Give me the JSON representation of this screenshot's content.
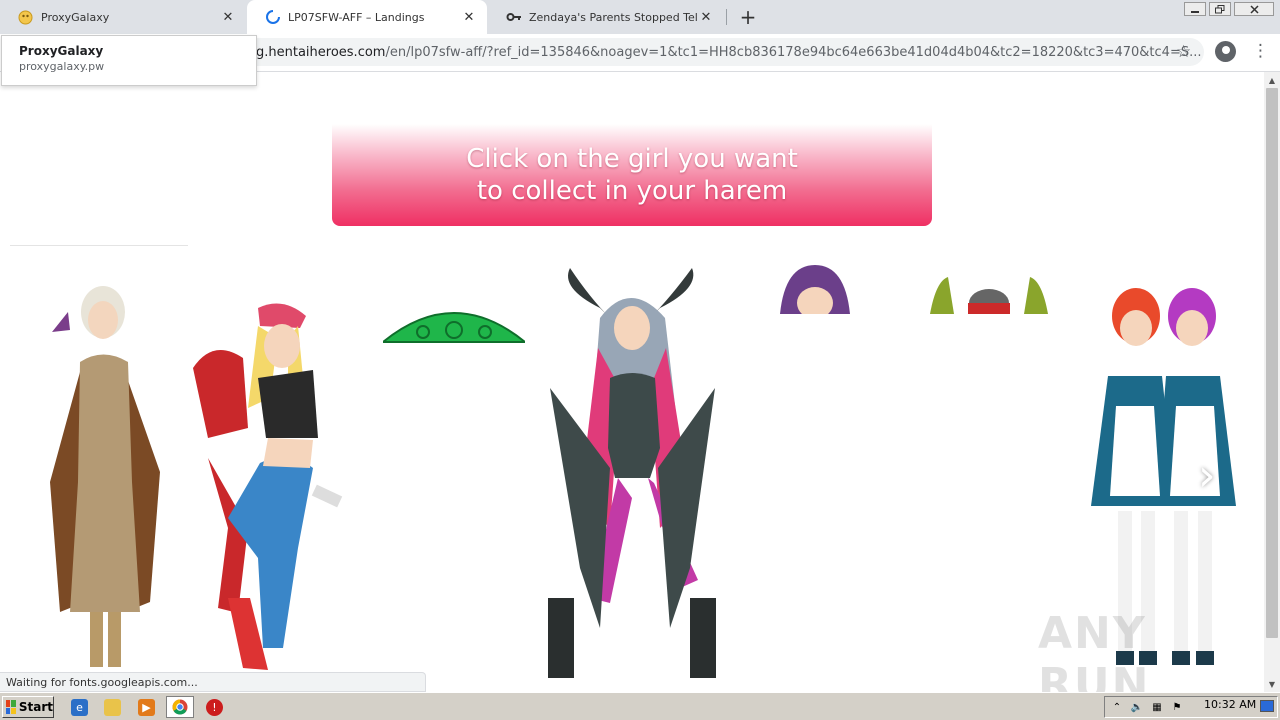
{
  "browser": {
    "tabs": [
      {
        "title": "ProxyGalaxy",
        "icon": "proxygalaxy-favicon",
        "active": false
      },
      {
        "title": "LP07SFW-AFF – Landings",
        "icon": "loading-spinner-icon",
        "active": true
      },
      {
        "title": "Zendaya's Parents Stopped Telling H",
        "icon": "key-icon",
        "active": false
      }
    ],
    "new_tab_glyph": "+",
    "close_glyph": "✕",
    "address": {
      "host": "g.hentaiheroes.com",
      "path": "/en/lp07sfw-aff/?ref_id=135846&noagev=1&tc1=HH8cb836178e94bc64e663be41d04d4b04&tc2=18220&tc3=470&tc4=S..."
    },
    "hover_card": {
      "title": "ProxyGalaxy",
      "subtitle": "proxygalaxy.pw"
    },
    "status_text": "Waiting for fonts.googleapis.com..."
  },
  "page": {
    "banner_line1": "Click on the girl you want",
    "banner_line2": "to collect in your harem",
    "watermark": "ANY RUN",
    "characters": [
      "girl-blonde-cloak",
      "girl-mechanic",
      "girl-green-hat-loading",
      "girl-succubus",
      "girl-purple-hair-loading",
      "girl-helmet-loading",
      "girls-twin-maids"
    ],
    "colors": {
      "banner_top": "#f9b9cb",
      "banner_bottom": "#ef2f63",
      "accent": "#ef2f63"
    }
  },
  "taskbar": {
    "start_label": "Start",
    "quick_launch": [
      "ie-icon",
      "folder-icon",
      "media-player-icon",
      "chrome-icon",
      "stop-icon"
    ],
    "clock": "10:32 AM"
  }
}
